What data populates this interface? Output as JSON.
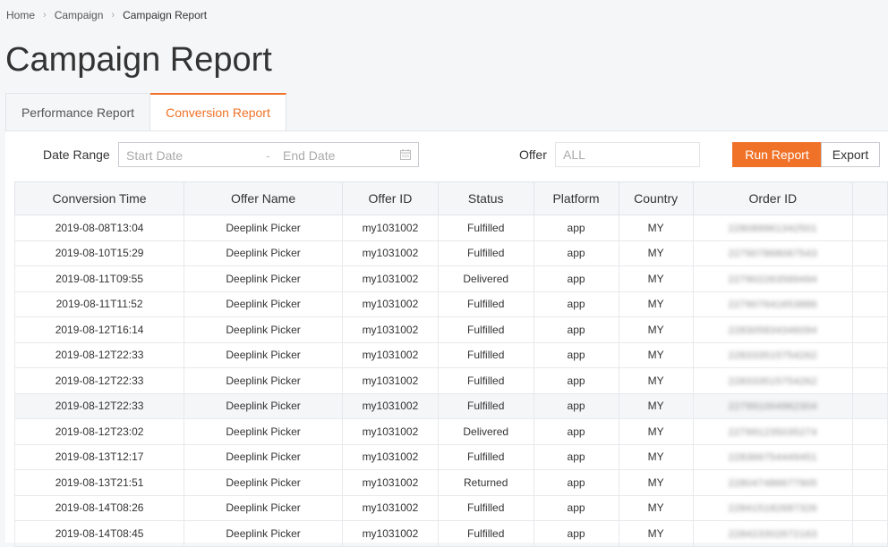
{
  "breadcrumb": {
    "items": [
      "Home",
      "Campaign",
      "Campaign Report"
    ]
  },
  "page": {
    "title": "Campaign Report"
  },
  "tabs": [
    {
      "label": "Performance Report",
      "active": false
    },
    {
      "label": "Conversion Report",
      "active": true
    }
  ],
  "filters": {
    "date_range_label": "Date Range",
    "start_placeholder": "Start Date",
    "separator": "-",
    "end_placeholder": "End Date",
    "offer_label": "Offer",
    "offer_placeholder": "ALL",
    "run_label": "Run Report",
    "export_label": "Export"
  },
  "colors": {
    "accent": "#f07228"
  },
  "table": {
    "columns": [
      "Conversion Time",
      "Offer Name",
      "Offer ID",
      "Status",
      "Platform",
      "Country",
      "Order ID",
      ""
    ],
    "order_id_note": "blurred",
    "rows": [
      {
        "time": "2019-08-08T13:04",
        "offer_name": "Deeplink Picker",
        "offer_id": "my1031002",
        "status": "Fulfilled",
        "platform": "app",
        "country": "MY",
        "order_id": "228089961342501"
      },
      {
        "time": "2019-08-10T15:29",
        "offer_name": "Deeplink Picker",
        "offer_id": "my1031002",
        "status": "Fulfilled",
        "platform": "app",
        "country": "MY",
        "order_id": "227907868067543"
      },
      {
        "time": "2019-08-11T09:55",
        "offer_name": "Deeplink Picker",
        "offer_id": "my1031002",
        "status": "Delivered",
        "platform": "app",
        "country": "MY",
        "order_id": "227902263589494"
      },
      {
        "time": "2019-08-11T11:52",
        "offer_name": "Deeplink Picker",
        "offer_id": "my1031002",
        "status": "Fulfilled",
        "platform": "app",
        "country": "MY",
        "order_id": "227907641653886"
      },
      {
        "time": "2019-08-12T16:14",
        "offer_name": "Deeplink Picker",
        "offer_id": "my1031002",
        "status": "Fulfilled",
        "platform": "app",
        "country": "MY",
        "order_id": "228305834346094"
      },
      {
        "time": "2019-08-12T22:33",
        "offer_name": "Deeplink Picker",
        "offer_id": "my1031002",
        "status": "Fulfilled",
        "platform": "app",
        "country": "MY",
        "order_id": "228333515754262"
      },
      {
        "time": "2019-08-12T22:33",
        "offer_name": "Deeplink Picker",
        "offer_id": "my1031002",
        "status": "Fulfilled",
        "platform": "app",
        "country": "MY",
        "order_id": "228333515754262"
      },
      {
        "time": "2019-08-12T22:33",
        "offer_name": "Deeplink Picker",
        "offer_id": "my1031002",
        "status": "Fulfilled",
        "platform": "app",
        "country": "MY",
        "order_id": "227991004962304",
        "highlighted": true
      },
      {
        "time": "2019-08-12T23:02",
        "offer_name": "Deeplink Picker",
        "offer_id": "my1031002",
        "status": "Delivered",
        "platform": "app",
        "country": "MY",
        "order_id": "227991235035274"
      },
      {
        "time": "2019-08-13T12:17",
        "offer_name": "Deeplink Picker",
        "offer_id": "my1031002",
        "status": "Fulfilled",
        "platform": "app",
        "country": "MY",
        "order_id": "228366754449451"
      },
      {
        "time": "2019-08-13T21:51",
        "offer_name": "Deeplink Picker",
        "offer_id": "my1031002",
        "status": "Returned",
        "platform": "app",
        "country": "MY",
        "order_id": "228047486677905"
      },
      {
        "time": "2019-08-14T08:26",
        "offer_name": "Deeplink Picker",
        "offer_id": "my1031002",
        "status": "Fulfilled",
        "platform": "app",
        "country": "MY",
        "order_id": "228415182687326"
      },
      {
        "time": "2019-08-14T08:45",
        "offer_name": "Deeplink Picker",
        "offer_id": "my1031002",
        "status": "Fulfilled",
        "platform": "app",
        "country": "MY",
        "order_id": "228423302672163"
      }
    ]
  }
}
